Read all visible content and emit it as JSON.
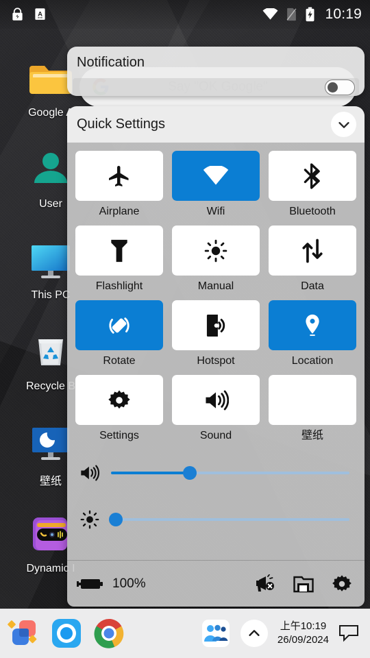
{
  "statusbar": {
    "left_icons": [
      {
        "name": "adb-lock-icon",
        "glyph": "lock"
      },
      {
        "name": "keyboard-indicator-icon",
        "glyph": "A"
      }
    ],
    "right_icons": [
      {
        "name": "wifi-icon"
      },
      {
        "name": "no-sim-icon"
      },
      {
        "name": "battery-charging-icon"
      }
    ],
    "clock": "10:19"
  },
  "desktop": {
    "icons": [
      {
        "label": "Google A",
        "icon": "folder-icon"
      },
      {
        "label": "User",
        "icon": "user-icon"
      },
      {
        "label": "This PC",
        "icon": "monitor-icon"
      },
      {
        "label": "Recycle B",
        "icon": "recycle-bin-icon"
      },
      {
        "label": "壁纸",
        "icon": "wallpaper-monitor-icon"
      },
      {
        "label": "Dynamic I",
        "icon": "dynamic-island-icon"
      }
    ]
  },
  "search_widget": {
    "placeholder": "Say \"OK Google\"",
    "left_icon": "google-g-icon",
    "right_icon": "assistant-mic-icon"
  },
  "notification": {
    "title": "Notification",
    "toggle_state": "off"
  },
  "quick_settings": {
    "title": "Quick Settings",
    "collapse_icon": "chevron-down-icon",
    "tiles": [
      {
        "label": "Airplane",
        "icon": "airplane-icon",
        "active": false
      },
      {
        "label": "Wifi",
        "icon": "wifi-icon",
        "active": true
      },
      {
        "label": "Bluetooth",
        "icon": "bluetooth-icon",
        "active": false
      },
      {
        "label": "Flashlight",
        "icon": "flashlight-icon",
        "active": false
      },
      {
        "label": "Manual",
        "icon": "brightness-icon",
        "active": false
      },
      {
        "label": "Data",
        "icon": "data-transfer-icon",
        "active": false
      },
      {
        "label": "Rotate",
        "icon": "rotate-icon",
        "active": true
      },
      {
        "label": "Hotspot",
        "icon": "hotspot-icon",
        "active": false
      },
      {
        "label": "Location",
        "icon": "location-pin-icon",
        "active": true
      },
      {
        "label": "Settings",
        "icon": "gear-icon",
        "active": false
      },
      {
        "label": "Sound",
        "icon": "speaker-icon",
        "active": false
      },
      {
        "label": "壁纸",
        "icon": "image-icon",
        "active": false
      }
    ],
    "sliders": [
      {
        "name": "volume",
        "icon": "speaker-icon",
        "value": 33
      },
      {
        "name": "brightness",
        "icon": "brightness-icon",
        "value": 2
      }
    ],
    "footer": {
      "battery_icon": "battery-charging-icon",
      "battery_percent": "100%",
      "actions": [
        {
          "name": "megaphone-off-icon"
        },
        {
          "name": "cast-screen-icon"
        },
        {
          "name": "gear-icon"
        }
      ]
    }
  },
  "taskbar": {
    "left_apps": [
      {
        "name": "taskbar-app-launcher-icon"
      },
      {
        "name": "taskbar-cortana-icon"
      },
      {
        "name": "taskbar-chrome-icon"
      }
    ],
    "right_items": [
      {
        "name": "people-icon"
      },
      {
        "name": "show-hidden-icons-chevron"
      }
    ],
    "time": "上午10:19",
    "date": "26/09/2024",
    "notification_icon": "speech-bubble-icon"
  },
  "colors": {
    "accent_blue": "#0b7ed3",
    "panel_header": "#ececec",
    "panel_body": "#cacaca",
    "taskbar": "#ececed",
    "teal": "#16a394",
    "folder_yellow": "#f5b429"
  }
}
